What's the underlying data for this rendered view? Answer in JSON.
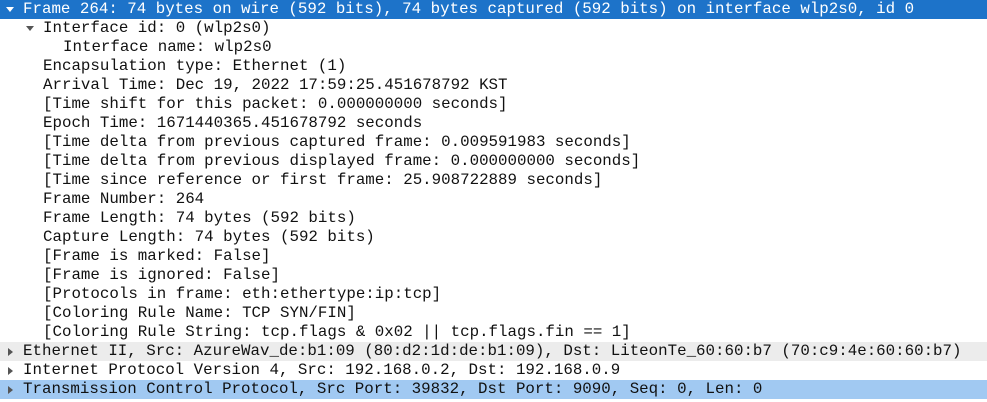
{
  "tree": {
    "frame": "Frame 264: 74 bytes on wire (592 bits), 74 bytes captured (592 bits) on interface wlp2s0, id 0",
    "interface_id": "Interface id: 0 (wlp2s0)",
    "interface_name": "Interface name: wlp2s0",
    "encapsulation": "Encapsulation type: Ethernet (1)",
    "arrival_time": "Arrival Time: Dec 19, 2022 17:59:25.451678792 KST",
    "time_shift": "[Time shift for this packet: 0.000000000 seconds]",
    "epoch_time": "Epoch Time: 1671440365.451678792 seconds",
    "delta_captured": "[Time delta from previous captured frame: 0.009591983 seconds]",
    "delta_displayed": "[Time delta from previous displayed frame: 0.000000000 seconds]",
    "time_since_ref": "[Time since reference or first frame: 25.908722889 seconds]",
    "frame_number": "Frame Number: 264",
    "frame_length": "Frame Length: 74 bytes (592 bits)",
    "capture_length": "Capture Length: 74 bytes (592 bits)",
    "is_marked": "[Frame is marked: False]",
    "is_ignored": "[Frame is ignored: False]",
    "protocols": "[Protocols in frame: eth:ethertype:ip:tcp]",
    "coloring_rule_name": "[Coloring Rule Name: TCP SYN/FIN]",
    "coloring_rule_string": "[Coloring Rule String: tcp.flags & 0x02 || tcp.flags.fin == 1]",
    "ethernet": "Ethernet II, Src: AzureWav_de:b1:09 (80:d2:1d:de:b1:09), Dst: LiteonTe_60:60:b7 (70:c9:4e:60:60:b7)",
    "ipv4": "Internet Protocol Version 4, Src: 192.168.0.2, Dst: 192.168.0.9",
    "tcp": "Transmission Control Protocol, Src Port: 39832, Dst Port: 9090, Seq: 0, Len: 0"
  },
  "colors": {
    "selected_row": "#1d73c9",
    "alternate_row": "#ececec",
    "highlight_row": "#a1c9f2"
  }
}
